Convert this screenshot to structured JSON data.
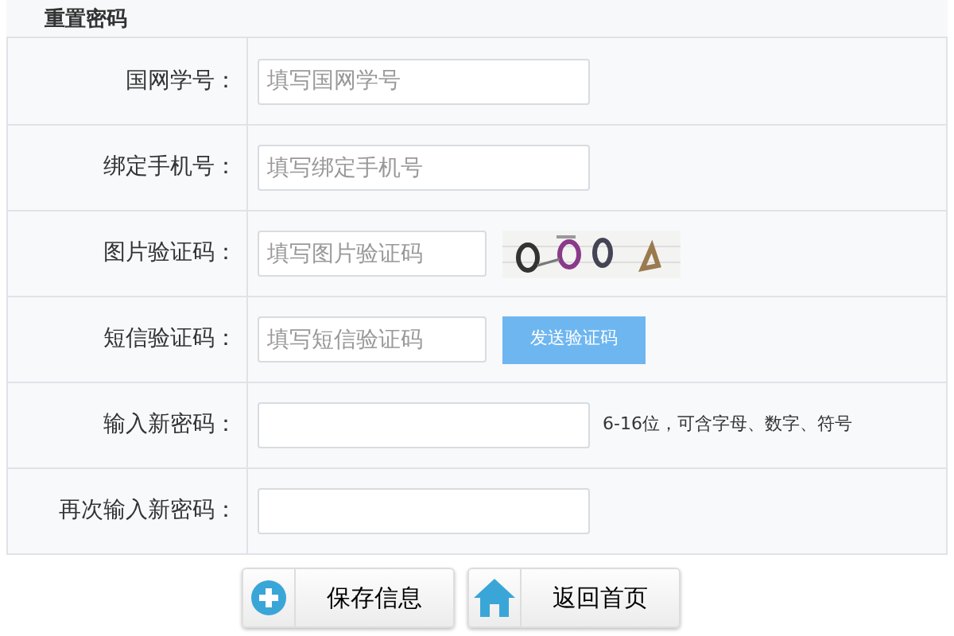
{
  "title": "重置密码",
  "rows": [
    {
      "kind": "plain",
      "label": "国网学号：",
      "placeholder": "填写国网学号"
    },
    {
      "kind": "plain",
      "label": "绑定手机号：",
      "placeholder": "填写绑定手机号"
    },
    {
      "kind": "captcha",
      "label": "图片验证码：",
      "placeholder": "填写图片验证码"
    },
    {
      "kind": "sms",
      "label": "短信验证码：",
      "placeholder": "填写短信验证码",
      "button": "发送验证码"
    },
    {
      "kind": "hint",
      "label": "输入新密码：",
      "hint": "6-16位，可含字母、数字、符号"
    },
    {
      "kind": "plain",
      "label": "再次输入新密码："
    }
  ],
  "buttons": [
    {
      "kind": "save",
      "label": "保存信息"
    },
    {
      "kind": "home",
      "label": "返回首页"
    }
  ]
}
